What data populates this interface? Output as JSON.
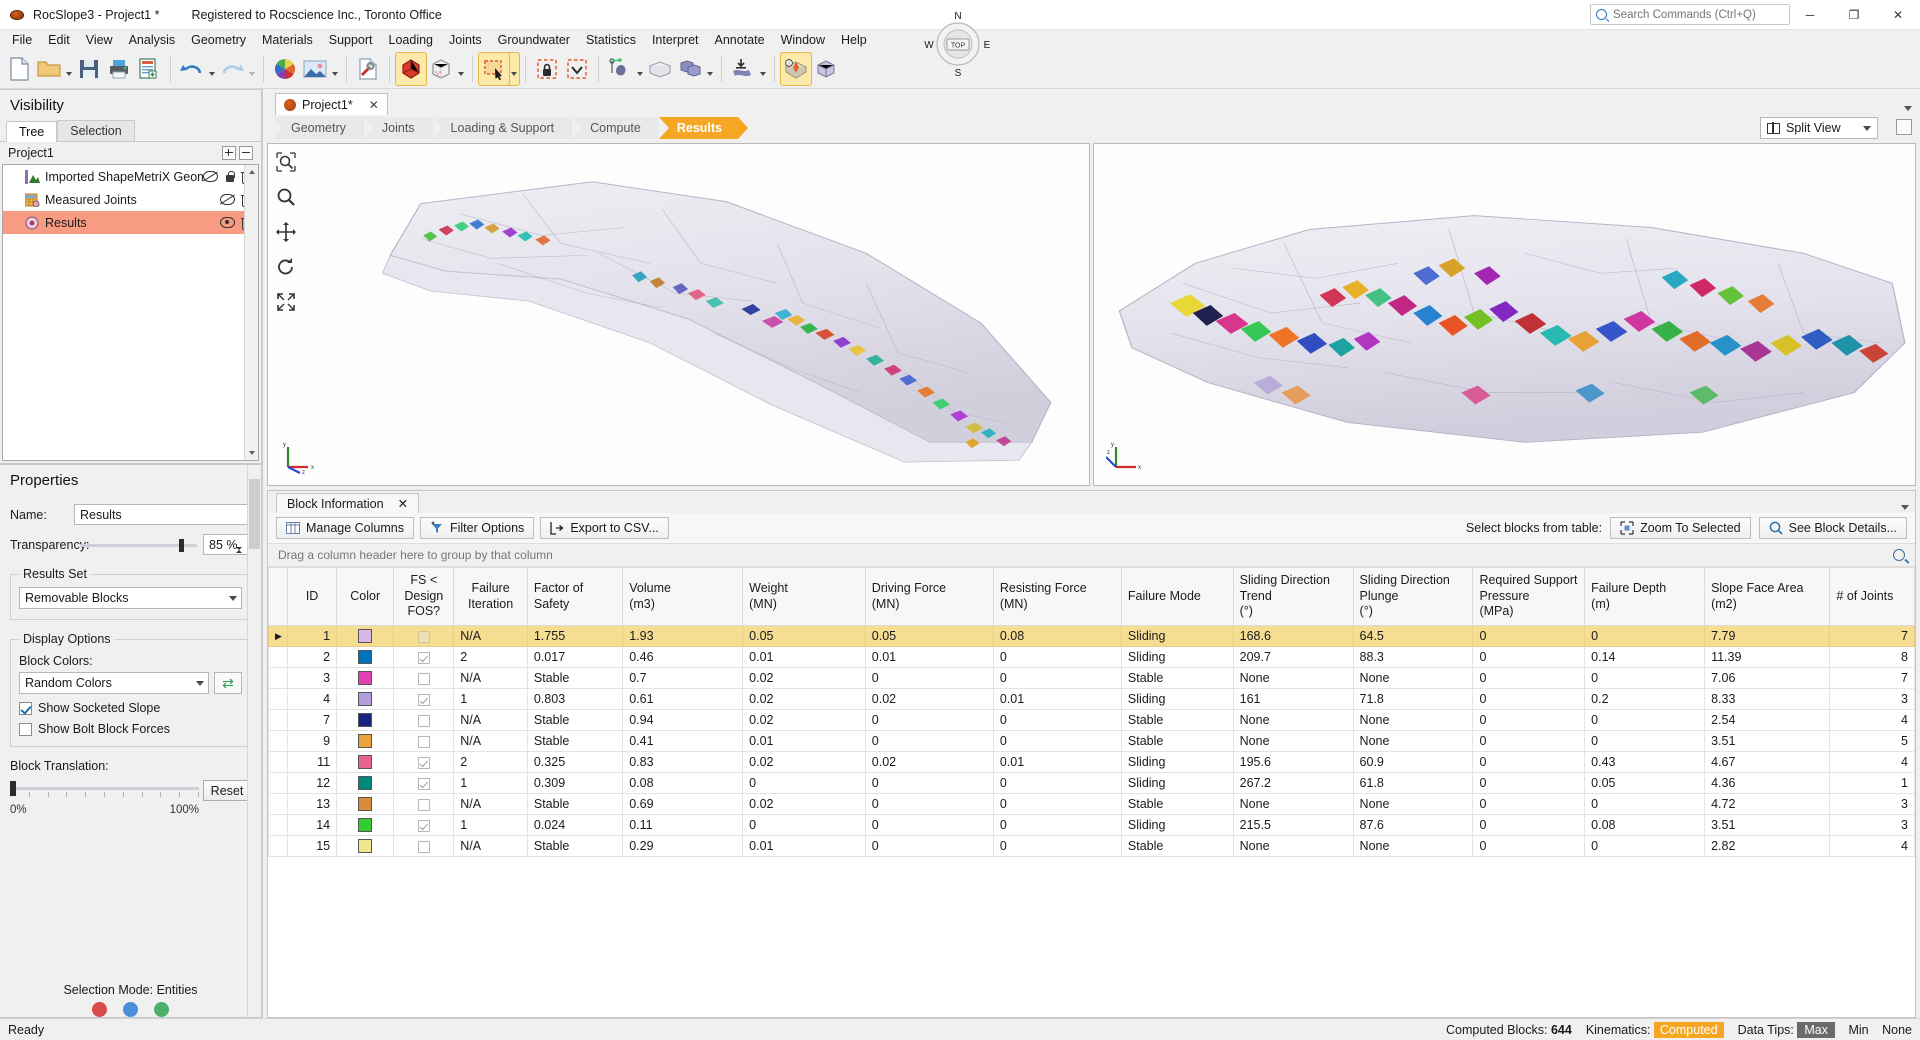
{
  "titlebar": {
    "app_title": "RocSlope3 - Project1 *",
    "registration": "Registered to Rocscience Inc., Toronto Office",
    "search_placeholder": "Search Commands (Ctrl+Q)",
    "minimize": "─",
    "maximize": "❐",
    "close": "✕"
  },
  "menubar": {
    "items": [
      "File",
      "Edit",
      "View",
      "Analysis",
      "Geometry",
      "Materials",
      "Support",
      "Loading",
      "Joints",
      "Groundwater",
      "Statistics",
      "Interpret",
      "Annotate",
      "Window",
      "Help"
    ]
  },
  "toolbar": {
    "icons": [
      "new-document",
      "open-folder",
      "save",
      "print",
      "report",
      "undo",
      "redo",
      "color-wheel",
      "image",
      "tools",
      "solid-block",
      "wireframe-block",
      "select-rectangle",
      "lock-selection",
      "select-down",
      "joint-plane",
      "excavation-box",
      "block-union",
      "export-surface",
      "block-info",
      "block-grid"
    ]
  },
  "visibility": {
    "title": "Visibility",
    "tabs": [
      {
        "label": "Tree",
        "active": true
      },
      {
        "label": "Selection",
        "active": false
      }
    ],
    "root": "Project1",
    "nodes": [
      {
        "label": "Imported ShapeMetriX Geometry",
        "icon": "mountain-icon",
        "visible": false,
        "locked": true,
        "deletable": true
      },
      {
        "label": "Measured Joints",
        "icon": "joints-table-icon",
        "visible": false,
        "locked": false,
        "deletable": true
      },
      {
        "label": "Results",
        "icon": "results-icon",
        "visible": true,
        "locked": false,
        "deletable": true,
        "selected": true
      }
    ]
  },
  "properties": {
    "title": "Properties",
    "name_label": "Name:",
    "name_value": "Results",
    "transparency_label": "Transparency:",
    "transparency_value": "85 %",
    "transparency_percent": 85,
    "results_set": {
      "legend": "Results Set",
      "value": "Removable Blocks"
    },
    "display_options": {
      "legend": "Display Options",
      "block_colors_label": "Block Colors:",
      "block_colors_value": "Random Colors",
      "shuffle_icon": "shuffle-icon",
      "show_socketed_slope": {
        "label": "Show Socketed Slope",
        "checked": true
      },
      "show_bolt_block_forces": {
        "label": "Show Bolt Block Forces",
        "checked": false
      }
    },
    "block_translation": {
      "legend": "Block Translation:",
      "min_label": "0%",
      "max_label": "100%",
      "reset_label": "Reset",
      "value_percent": 0
    },
    "selection_mode_label": "Selection Mode:",
    "selection_mode_value": "Entities"
  },
  "document_tabs": [
    {
      "label": "Project1*",
      "active": true,
      "close": "✕"
    }
  ],
  "workflow": {
    "steps": [
      {
        "label": "Geometry",
        "active": false
      },
      {
        "label": "Joints",
        "active": false
      },
      {
        "label": "Loading & Support",
        "active": false
      },
      {
        "label": "Compute",
        "active": false
      },
      {
        "label": "Results",
        "active": true
      }
    ],
    "split_view_label": "Split View",
    "split_view_icon": "split-view-icon"
  },
  "viewport": {
    "tools": [
      "zoom-window-icon",
      "zoom-icon",
      "pan-icon",
      "rotate-icon",
      "zoom-all-icon"
    ],
    "compass": {
      "north": "N",
      "south": "S",
      "east": "E",
      "west": "W",
      "center": "TOP"
    },
    "axis_left": [
      "y",
      "x",
      "z"
    ],
    "axis_right": [
      "y",
      "z",
      "x"
    ]
  },
  "block_information": {
    "tab_label": "Block Information",
    "tab_close": "✕",
    "buttons": [
      {
        "label": "Manage Columns",
        "icon": "columns-icon"
      },
      {
        "label": "Filter Options",
        "icon": "filter-icon"
      },
      {
        "label": "Export to CSV...",
        "icon": "export-icon"
      }
    ],
    "select_blocks_label": "Select blocks from table:",
    "zoom_to_selected": {
      "label": "Zoom To Selected",
      "icon": "zoom-selected-icon"
    },
    "see_block_details": {
      "label": "See Block Details...",
      "icon": "details-icon"
    },
    "group_hint": "Drag a column header here to group by that column",
    "search_icon": "search-icon",
    "columns": [
      "ID",
      "Color",
      "FS < Design FOS?",
      "Failure Iteration",
      "Factor of Safety",
      "Volume (m3)",
      "Weight (MN)",
      "Driving Force (MN)",
      "Resisting Force (MN)",
      "Failure Mode",
      "Sliding Direction Trend (°)",
      "Sliding Direction Plunge (°)",
      "Required Support Pressure (MPa)",
      "Failure Depth (m)",
      "Slope Face Area (m2)",
      "# of Joints"
    ],
    "rows": [
      {
        "id": "1",
        "color": "#d9b8e8",
        "fs_flag": "none",
        "failure_iteration": "N/A",
        "fos": "1.755",
        "volume": "1.93",
        "weight": "0.05",
        "driving": "0.05",
        "resisting": "0.08",
        "mode": "Sliding",
        "trend": "168.6",
        "plunge": "64.5",
        "support": "0",
        "depth": "0",
        "area": "7.79",
        "joints": "7",
        "selected": true
      },
      {
        "id": "2",
        "color": "#0072bc",
        "fs_flag": "checked",
        "failure_iteration": "2",
        "fos": "0.017",
        "volume": "0.46",
        "weight": "0.01",
        "driving": "0.01",
        "resisting": "0",
        "mode": "Sliding",
        "trend": "209.7",
        "plunge": "88.3",
        "support": "0",
        "depth": "0.14",
        "area": "11.39",
        "joints": "8",
        "selected": false
      },
      {
        "id": "3",
        "color": "#e040b0",
        "fs_flag": "none",
        "failure_iteration": "N/A",
        "fos": "Stable",
        "volume": "0.7",
        "weight": "0.02",
        "driving": "0",
        "resisting": "0",
        "mode": "Stable",
        "trend": "None",
        "plunge": "None",
        "support": "0",
        "depth": "0",
        "area": "7.06",
        "joints": "7",
        "selected": false
      },
      {
        "id": "4",
        "color": "#b39ddb",
        "fs_flag": "checked",
        "failure_iteration": "1",
        "fos": "0.803",
        "volume": "0.61",
        "weight": "0.02",
        "driving": "0.02",
        "resisting": "0.01",
        "mode": "Sliding",
        "trend": "161",
        "plunge": "71.8",
        "support": "0",
        "depth": "0.2",
        "area": "8.33",
        "joints": "3",
        "selected": false
      },
      {
        "id": "7",
        "color": "#1a237e",
        "fs_flag": "none",
        "failure_iteration": "N/A",
        "fos": "Stable",
        "volume": "0.94",
        "weight": "0.02",
        "driving": "0",
        "resisting": "0",
        "mode": "Stable",
        "trend": "None",
        "plunge": "None",
        "support": "0",
        "depth": "0",
        "area": "2.54",
        "joints": "4",
        "selected": false
      },
      {
        "id": "9",
        "color": "#e8a33d",
        "fs_flag": "none",
        "failure_iteration": "N/A",
        "fos": "Stable",
        "volume": "0.41",
        "weight": "0.01",
        "driving": "0",
        "resisting": "0",
        "mode": "Stable",
        "trend": "None",
        "plunge": "None",
        "support": "0",
        "depth": "0",
        "area": "3.51",
        "joints": "5",
        "selected": false
      },
      {
        "id": "11",
        "color": "#e8628c",
        "fs_flag": "checked",
        "failure_iteration": "2",
        "fos": "0.325",
        "volume": "0.83",
        "weight": "0.02",
        "driving": "0.02",
        "resisting": "0.01",
        "mode": "Sliding",
        "trend": "195.6",
        "plunge": "60.9",
        "support": "0",
        "depth": "0.43",
        "area": "4.67",
        "joints": "4",
        "selected": false
      },
      {
        "id": "12",
        "color": "#00897b",
        "fs_flag": "checked",
        "failure_iteration": "1",
        "fos": "0.309",
        "volume": "0.08",
        "weight": "0",
        "driving": "0",
        "resisting": "0",
        "mode": "Sliding",
        "trend": "267.2",
        "plunge": "61.8",
        "support": "0",
        "depth": "0.05",
        "area": "4.36",
        "joints": "1",
        "selected": false
      },
      {
        "id": "13",
        "color": "#d98c3a",
        "fs_flag": "none",
        "failure_iteration": "N/A",
        "fos": "Stable",
        "volume": "0.69",
        "weight": "0.02",
        "driving": "0",
        "resisting": "0",
        "mode": "Stable",
        "trend": "None",
        "plunge": "None",
        "support": "0",
        "depth": "0",
        "area": "4.72",
        "joints": "3",
        "selected": false
      },
      {
        "id": "14",
        "color": "#33cc33",
        "fs_flag": "checked",
        "failure_iteration": "1",
        "fos": "0.024",
        "volume": "0.11",
        "weight": "0",
        "driving": "0",
        "resisting": "0",
        "mode": "Sliding",
        "trend": "215.5",
        "plunge": "87.6",
        "support": "0",
        "depth": "0.08",
        "area": "3.51",
        "joints": "3",
        "selected": false
      },
      {
        "id": "15",
        "color": "#f0e68c",
        "fs_flag": "none",
        "failure_iteration": "N/A",
        "fos": "Stable",
        "volume": "0.29",
        "weight": "0.01",
        "driving": "0",
        "resisting": "0",
        "mode": "Stable",
        "trend": "None",
        "plunge": "None",
        "support": "0",
        "depth": "0",
        "area": "2.82",
        "joints": "4",
        "selected": false
      }
    ]
  },
  "statusbar": {
    "ready": "Ready",
    "computed_blocks_label": "Computed Blocks:",
    "computed_blocks_value": "644",
    "kinematics_label": "Kinematics:",
    "kinematics_value": "Computed",
    "data_tips_label": "Data Tips:",
    "data_tips_max": "Max",
    "data_tips_min": "Min",
    "data_tips_none": "None"
  },
  "colors": {
    "accent_orange": "#f5a623",
    "selection_salmon": "#f79c82",
    "row_highlight": "#f5dd92",
    "brand_rock": "#9c3d10"
  }
}
